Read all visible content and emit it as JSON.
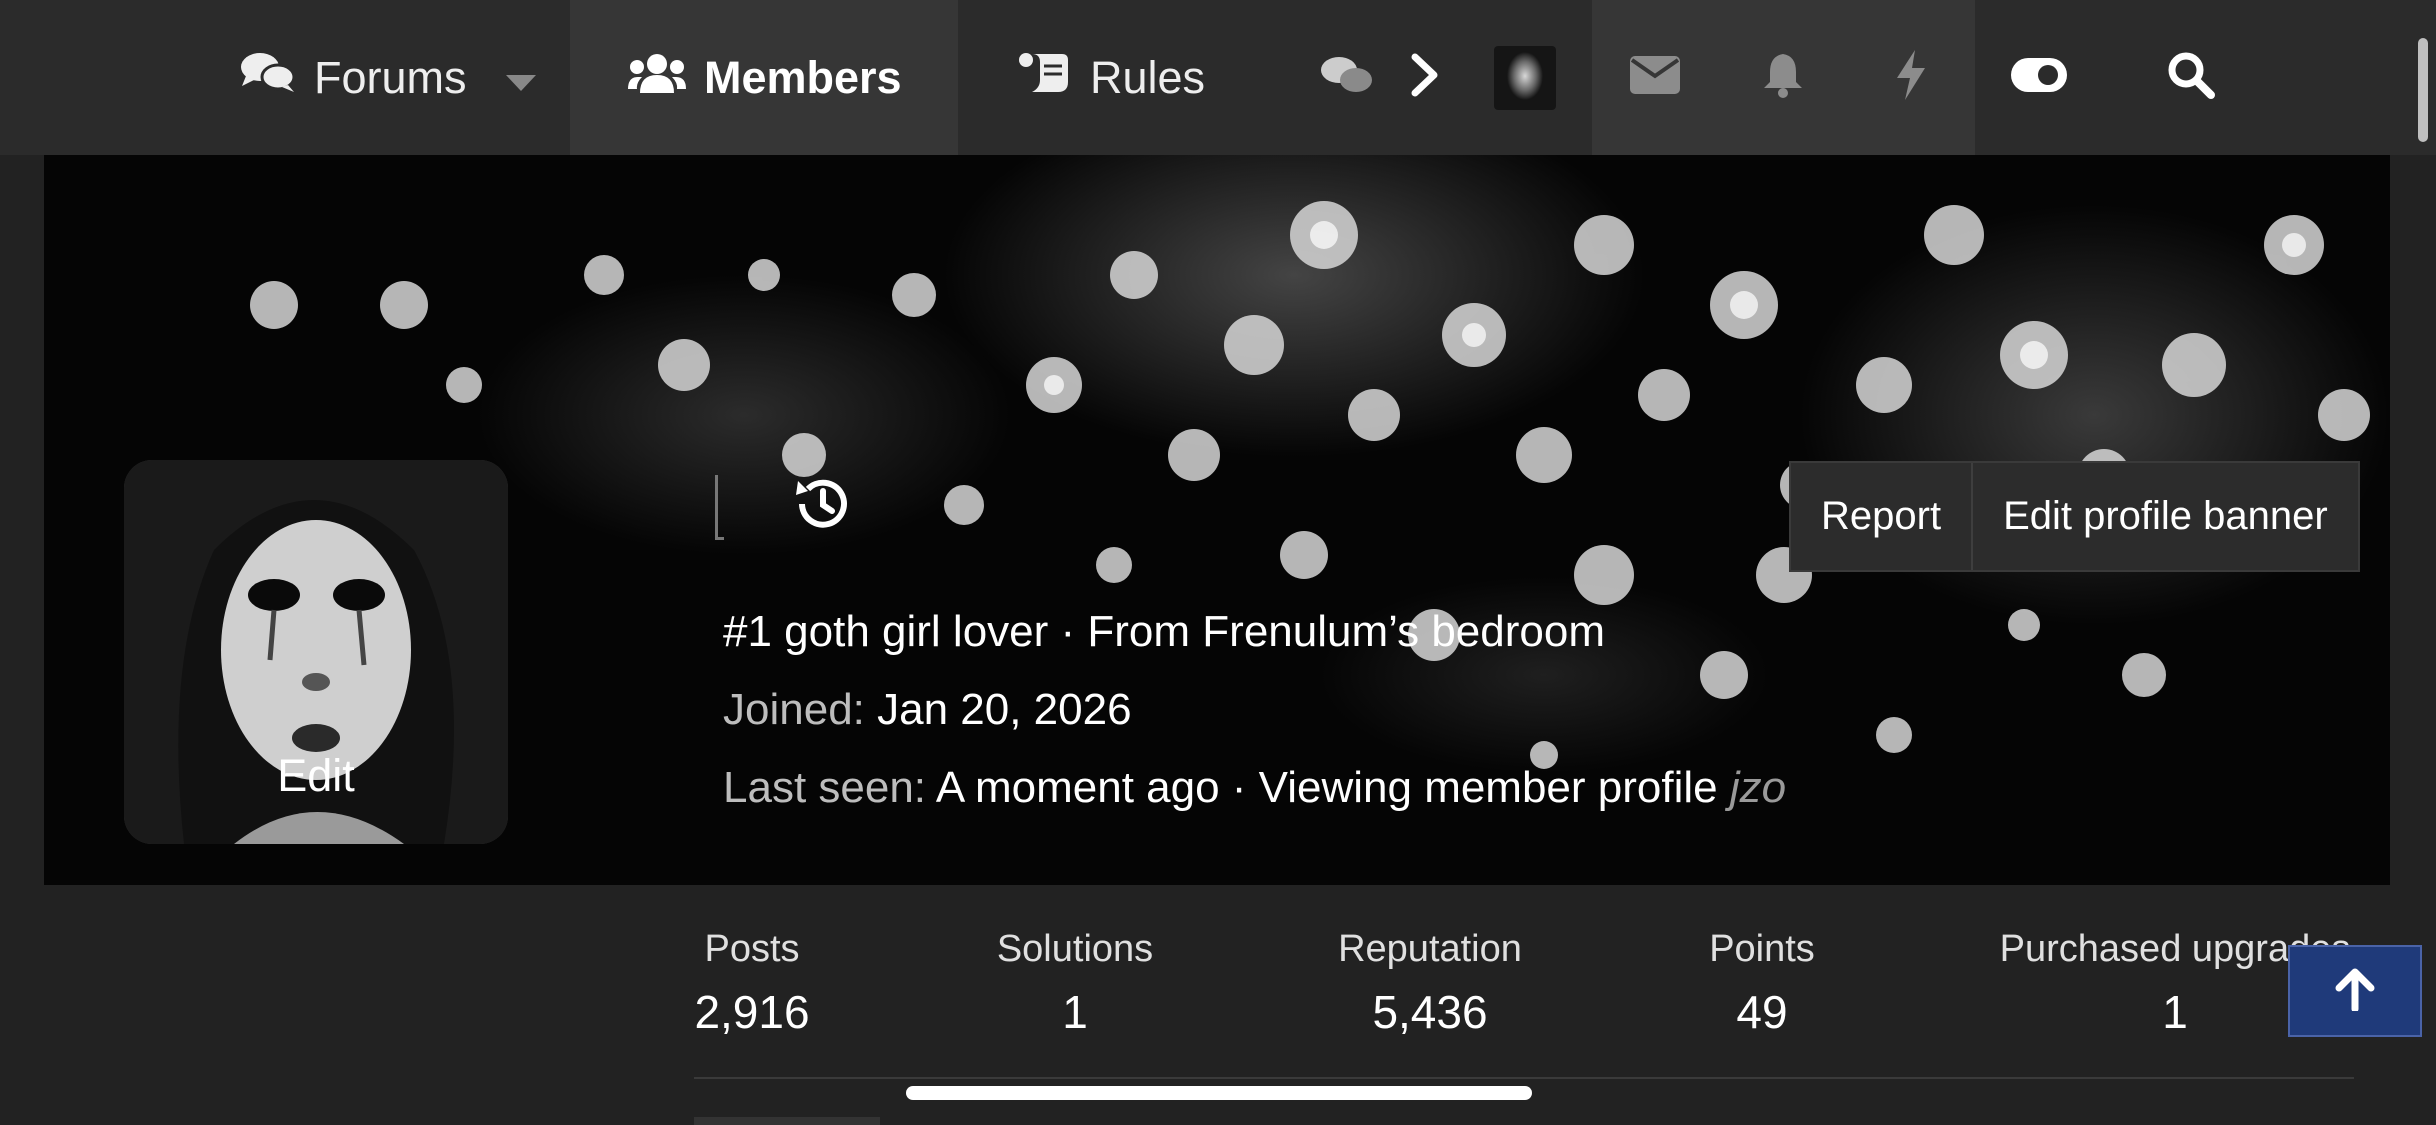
{
  "nav": {
    "forums": "Forums",
    "members": "Members",
    "rules": "Rules"
  },
  "icons": {
    "forums": "comments-icon",
    "members": "users-icon",
    "rules": "scroll-icon",
    "chat": "chat-bubbles-icon",
    "more": "chevron-right-icon",
    "inbox": "envelope-icon",
    "alerts": "bell-icon",
    "whats_new": "bolt-icon",
    "theme": "toggle-icon",
    "search": "search-icon",
    "history": "history-icon",
    "back_to_top": "arrow-up-icon"
  },
  "profile": {
    "avatar_edit": "Edit",
    "title": "#1 goth girl lover",
    "separator": " · ",
    "location": "From Frenulum’s bedroom",
    "joined_label": "Joined:",
    "joined_value": "Jan 20, 2026",
    "last_seen_label": "Last seen:",
    "last_seen_value": "A moment ago",
    "activity": "Viewing member profile",
    "activity_user": "jzo",
    "report": "Report",
    "edit_banner": "Edit profile banner"
  },
  "stats": [
    {
      "label": "Posts",
      "value": "2,916"
    },
    {
      "label": "Solutions",
      "value": "1"
    },
    {
      "label": "Reputation",
      "value": "5,436"
    },
    {
      "label": "Points",
      "value": "49"
    },
    {
      "label": "Purchased upgrades",
      "value": "1"
    }
  ],
  "colors": {
    "nav_bg": "#2b2b2b",
    "nav_active": "#363636",
    "page_bg": "#222222",
    "accent_button": "#1f3a7a"
  }
}
